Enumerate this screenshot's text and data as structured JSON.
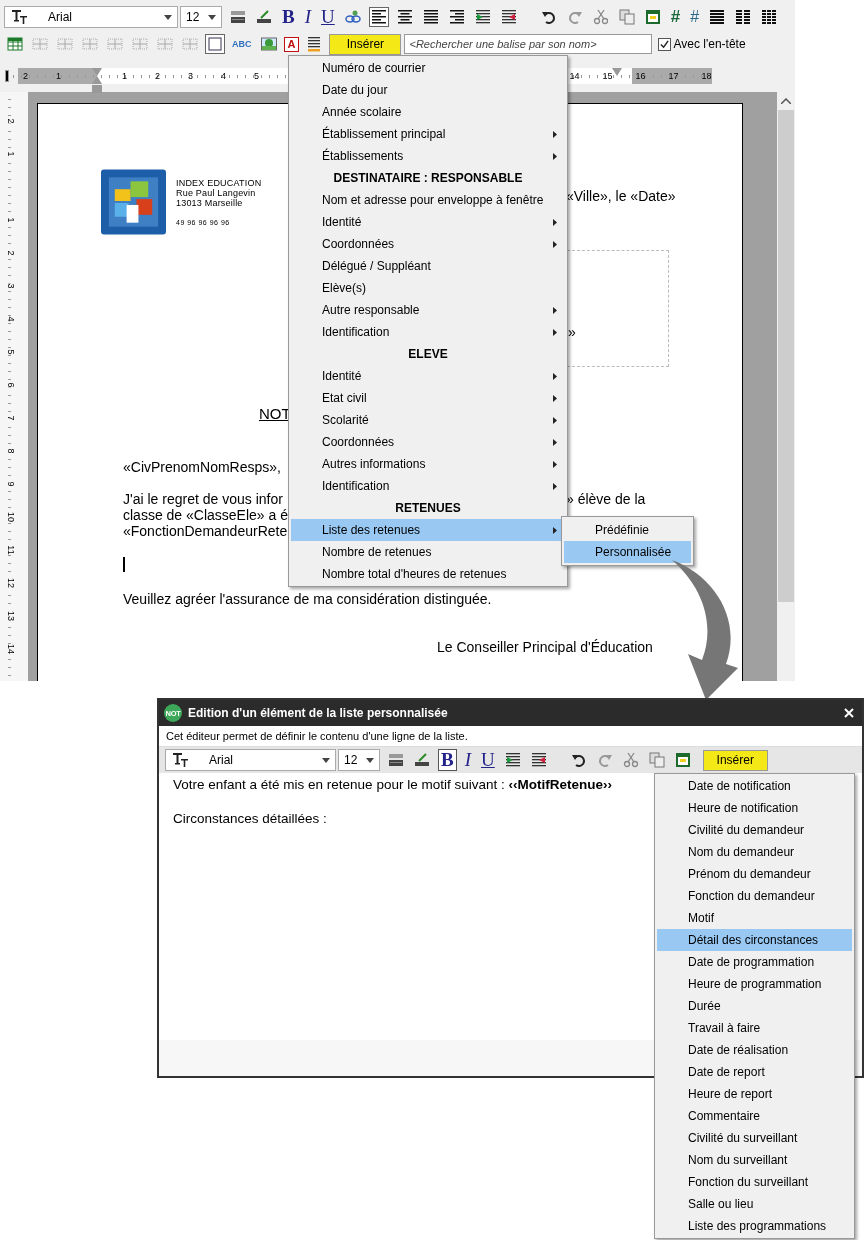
{
  "editor": {
    "font_name": "Arial",
    "font_size": "12",
    "format_glyphs": [
      "B",
      "I",
      "U"
    ],
    "align_left_pressed": true,
    "number_glyphs": [
      "#",
      "#"
    ],
    "frame_pressed": true,
    "text_color_glyph": "ABC",
    "text_frame_glyph": "A",
    "insert_button": "Insérer",
    "search": {
      "placeholder": "<Rechercher une balise par son nom>"
    },
    "header_checkbox": {
      "label": "Avec l'en-tête",
      "checked": true
    },
    "ruler": {
      "before_origin": [
        "2",
        "1"
      ],
      "after_origin": [
        "1",
        "2",
        "3",
        "4",
        "5"
      ],
      "far": [
        "14",
        "15",
        "16",
        "17",
        "18"
      ]
    },
    "vertical_ruler": {
      "before_origin": [
        "2",
        "1"
      ],
      "after_origin": [
        "1",
        "2",
        "3",
        "4",
        "5",
        "6",
        "7",
        "8",
        "9",
        "10",
        "11",
        "12",
        "13",
        "14"
      ]
    },
    "page": {
      "letterhead": [
        "INDEX EDUCATION",
        "Rue Paul Langevin",
        "13013 Marseille"
      ],
      "phone": "49 96 96 96 96",
      "place_date": "«Ville», le «Date»",
      "address_end": "»",
      "title": "NOT",
      "salutation": "«CivPrenomNomResps»,",
      "body_left": [
        "J'ai le regret de vous infor",
        "classe de «ClasseEle» a é",
        "«FonctionDemandeurRete"
      ],
      "body_right": "» élève de la",
      "closing": "Veuillez agréer l'assurance de ma considération distinguée.",
      "signature": "Le Conseiller Principal d'Éducation"
    }
  },
  "insert_menu": [
    {
      "kind": "item",
      "label": "Numéro de courrier",
      "has_submenu": false,
      "selected": false
    },
    {
      "kind": "item",
      "label": "Date du jour",
      "has_submenu": false,
      "selected": false
    },
    {
      "kind": "item",
      "label": "Année scolaire",
      "has_submenu": false,
      "selected": false
    },
    {
      "kind": "item",
      "label": "Établissement principal",
      "has_submenu": true,
      "selected": false
    },
    {
      "kind": "item",
      "label": "Établissements",
      "has_submenu": true,
      "selected": false
    },
    {
      "kind": "header",
      "label": "DESTINATAIRE : RESPONSABLE"
    },
    {
      "kind": "item",
      "label": "Nom et adresse pour enveloppe à fenêtre",
      "has_submenu": false,
      "selected": false
    },
    {
      "kind": "item",
      "label": "Identité",
      "has_submenu": true,
      "selected": false
    },
    {
      "kind": "item",
      "label": "Coordonnées",
      "has_submenu": true,
      "selected": false
    },
    {
      "kind": "item",
      "label": "Délégué / Suppléant",
      "has_submenu": false,
      "selected": false
    },
    {
      "kind": "item",
      "label": "Elève(s)",
      "has_submenu": false,
      "selected": false
    },
    {
      "kind": "item",
      "label": "Autre responsable",
      "has_submenu": true,
      "selected": false
    },
    {
      "kind": "item",
      "label": "Identification",
      "has_submenu": true,
      "selected": false
    },
    {
      "kind": "header",
      "label": "ELEVE"
    },
    {
      "kind": "item",
      "label": "Identité",
      "has_submenu": true,
      "selected": false
    },
    {
      "kind": "item",
      "label": "Etat civil",
      "has_submenu": true,
      "selected": false
    },
    {
      "kind": "item",
      "label": "Scolarité",
      "has_submenu": true,
      "selected": false
    },
    {
      "kind": "item",
      "label": "Coordonnées",
      "has_submenu": true,
      "selected": false
    },
    {
      "kind": "item",
      "label": "Autres informations",
      "has_submenu": true,
      "selected": false
    },
    {
      "kind": "item",
      "label": "Identification",
      "has_submenu": true,
      "selected": false
    },
    {
      "kind": "header",
      "label": "RETENUES"
    },
    {
      "kind": "item",
      "label": "Liste des retenues",
      "has_submenu": true,
      "selected": true
    },
    {
      "kind": "item",
      "label": "Nombre de retenues",
      "has_submenu": false,
      "selected": false
    },
    {
      "kind": "item",
      "label": "Nombre total d'heures de retenues",
      "has_submenu": false,
      "selected": false
    }
  ],
  "submenu": [
    {
      "label": "Prédéfinie",
      "selected": false
    },
    {
      "label": "Personnalisée",
      "selected": true
    }
  ],
  "dialog": {
    "badge": "NOT",
    "title": "Edition d'un élément de la liste personnalisée",
    "description": "Cet éditeur permet de définir le contenu d'une ligne de la liste.",
    "font_name": "Arial",
    "font_size": "12",
    "format_glyphs": [
      "B",
      "I",
      "U"
    ],
    "bold_pressed": true,
    "insert_button": "Insérer",
    "lines": [
      "Votre enfant a été mis en retenue pour le motif suivant : **‹‹MotifRetenue››**",
      "Circonstances détaillées :"
    ],
    "insert_menu": [
      {
        "label": "Date de notification",
        "selected": false
      },
      {
        "label": "Heure de notification",
        "selected": false
      },
      {
        "label": "Civilité du demandeur",
        "selected": false
      },
      {
        "label": "Nom du demandeur",
        "selected": false
      },
      {
        "label": "Prénom du demandeur",
        "selected": false
      },
      {
        "label": "Fonction du demandeur",
        "selected": false
      },
      {
        "label": "Motif",
        "selected": false
      },
      {
        "label": "Détail des circonstances",
        "selected": true
      },
      {
        "label": "Date de programmation",
        "selected": false
      },
      {
        "label": "Heure de programmation",
        "selected": false
      },
      {
        "label": "Durée",
        "selected": false
      },
      {
        "label": "Travail à faire",
        "selected": false
      },
      {
        "label": "Date de réalisation",
        "selected": false
      },
      {
        "label": "Date de report",
        "selected": false
      },
      {
        "label": "Heure de report",
        "selected": false
      },
      {
        "label": "Commentaire",
        "selected": false
      },
      {
        "label": "Civilité du surveillant",
        "selected": false
      },
      {
        "label": "Nom du surveillant",
        "selected": false
      },
      {
        "label": "Fonction du surveillant",
        "selected": false
      },
      {
        "label": "Salle ou lieu",
        "selected": false
      },
      {
        "label": "Liste des programmations",
        "selected": false
      }
    ]
  }
}
